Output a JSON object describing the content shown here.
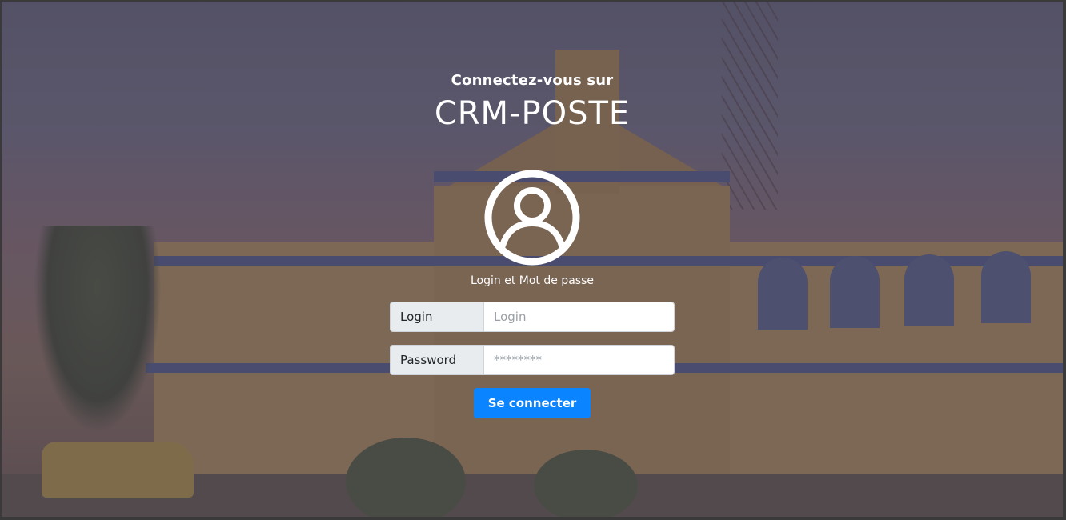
{
  "header": {
    "subtitle": "Connectez-vous sur",
    "title": "CRM-POSTE"
  },
  "avatar": {
    "icon": "user-circle-icon",
    "caption": "Login et Mot de passe"
  },
  "form": {
    "login": {
      "label": "Login",
      "placeholder": "Login",
      "value": ""
    },
    "password": {
      "label": "Password",
      "placeholder": "********",
      "value": ""
    },
    "submit_label": "Se connecter"
  },
  "colors": {
    "accent": "#0a84ff",
    "overlay": "#463749",
    "text": "#ffffff",
    "addon_bg": "#e9ecef"
  }
}
